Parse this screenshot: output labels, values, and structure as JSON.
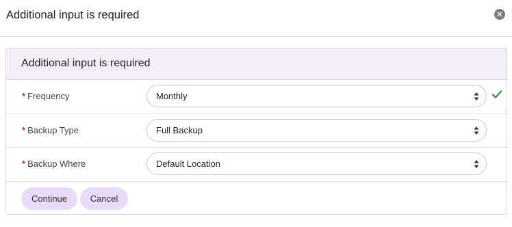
{
  "dialog": {
    "title": "Additional input is required",
    "close_icon": "close-icon"
  },
  "panel": {
    "heading": "Additional input is required",
    "required_marker": "*",
    "fields": [
      {
        "label": "Frequency",
        "value": "Monthly",
        "valid": true
      },
      {
        "label": "Backup Type",
        "value": "Full Backup",
        "valid": false
      },
      {
        "label": "Backup Where",
        "value": "Default Location",
        "valid": false
      }
    ]
  },
  "actions": {
    "continue_label": "Continue",
    "cancel_label": "Cancel"
  },
  "colors": {
    "accent_bg": "#e9dcfa",
    "heading_bg": "#f3eef7",
    "required": "#c0392b",
    "valid_check": "#3c9a3c"
  }
}
